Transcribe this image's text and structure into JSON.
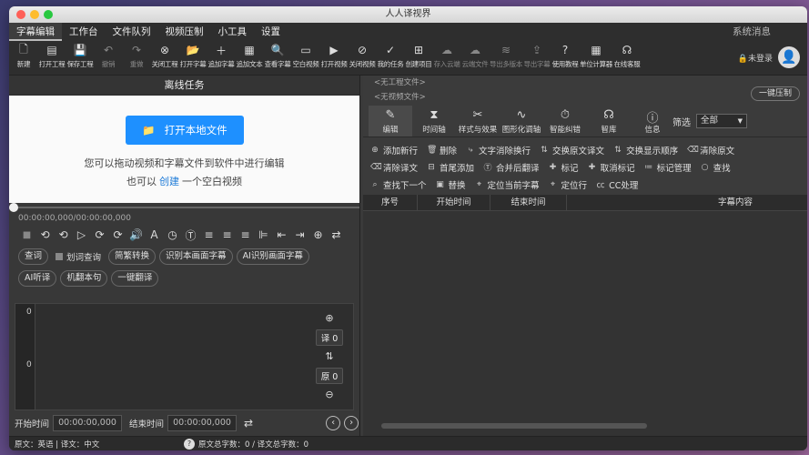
{
  "window": {
    "title": "人人译视界"
  },
  "menu": {
    "items": [
      "字幕编辑",
      "工作台",
      "文件队列",
      "视频压制",
      "小工具",
      "设置"
    ],
    "active_index": 0,
    "system_message": "系统消息"
  },
  "toolbar": {
    "items": [
      {
        "label": "新建",
        "icon": "new-file-icon",
        "glyph": "🗋"
      },
      {
        "label": "打开工程",
        "icon": "open-project-icon",
        "glyph": "▤"
      },
      {
        "label": "保存工程",
        "icon": "save-icon",
        "glyph": "💾"
      },
      {
        "label": "撤销",
        "icon": "undo-icon",
        "glyph": "↶"
      },
      {
        "label": "重做",
        "icon": "redo-icon",
        "glyph": "↷"
      },
      {
        "label": "关闭工程",
        "icon": "close-project-icon",
        "glyph": "⊗"
      },
      {
        "label": "打开字幕",
        "icon": "open-subtitle-icon",
        "glyph": "📂"
      },
      {
        "label": "追加字幕",
        "icon": "append-subtitle-icon",
        "glyph": "＋"
      },
      {
        "label": "追加文本",
        "icon": "append-text-icon",
        "glyph": "▦"
      },
      {
        "label": "查看字幕",
        "icon": "view-subtitle-icon",
        "glyph": "🔍"
      },
      {
        "label": "空白视频",
        "icon": "blank-video-icon",
        "glyph": "▭"
      },
      {
        "label": "打开视频",
        "icon": "open-video-icon",
        "glyph": "▶"
      },
      {
        "label": "关闭视频",
        "icon": "close-video-icon",
        "glyph": "⊘"
      },
      {
        "label": "我的任务",
        "icon": "task-icon",
        "glyph": "✓"
      },
      {
        "label": "创建项目",
        "icon": "create-project-icon",
        "glyph": "⊞"
      },
      {
        "label": "存入云端",
        "icon": "cloud-save-icon",
        "glyph": "☁"
      },
      {
        "label": "云端文件",
        "icon": "cloud-file-icon",
        "glyph": "☁"
      },
      {
        "label": "导出多版本",
        "icon": "export-versions-icon",
        "glyph": "≋"
      },
      {
        "label": "导出字幕",
        "icon": "export-subtitle-icon",
        "glyph": "⇪"
      },
      {
        "label": "使用教程",
        "icon": "help-icon",
        "glyph": "?"
      },
      {
        "label": "单位计算器",
        "icon": "calculator-icon",
        "glyph": "▦"
      },
      {
        "label": "在线客服",
        "icon": "headset-icon",
        "glyph": "☊"
      }
    ],
    "login_label": "未登录"
  },
  "left_panel": {
    "title": "离线任务",
    "open_button": "打开本地文件",
    "hint_line1": "您可以拖动视频和字幕文件到软件中进行编辑",
    "hint_prefix": "也可以",
    "hint_link": "创建",
    "hint_suffix": "一个空白视频",
    "timecode": "00:00:00,000/00:00:00,000",
    "row1": {
      "query": "查词",
      "check_label": "划词查询",
      "convert": "简繁转换",
      "recognize": "识别本画面字幕",
      "ai_recognize": "AI识别画面字幕"
    },
    "row2": {
      "ai_listen": "AI听译",
      "machine": "机翻本句",
      "one_click": "一键翻译"
    },
    "editor": {
      "line_top": "0",
      "line_bottom": "0",
      "translation_count": "译 0",
      "original_count": "原 0"
    },
    "start_label": "开始时间",
    "start_value": "00:00:00,000",
    "end_label": "结束时间",
    "end_value": "00:00:00,000"
  },
  "right_panel": {
    "project_line1": "<无工程文件>",
    "project_line2": "<无视频文件>",
    "compress_button": "一键压制",
    "tabs": [
      {
        "label": "编辑",
        "icon": "edit-icon",
        "glyph": "✎"
      },
      {
        "label": "时间轴",
        "icon": "timeline-icon",
        "glyph": "⧗"
      },
      {
        "label": "样式与效果",
        "icon": "style-icon",
        "glyph": "✂"
      },
      {
        "label": "图形化调轴",
        "icon": "graph-icon",
        "glyph": "∿"
      },
      {
        "label": "智能纠错",
        "icon": "smart-fix-icon",
        "glyph": "⏱"
      },
      {
        "label": "智库",
        "icon": "library-icon",
        "glyph": "☊"
      },
      {
        "label": "信息",
        "icon": "info-icon",
        "glyph": "ⓘ"
      }
    ],
    "filter_label": "筛选",
    "filter_value": "全部",
    "actions_row1": [
      {
        "label": "添加新行",
        "glyph": "⊕",
        "icon": "add-row-icon"
      },
      {
        "label": "删除",
        "glyph": "🗑",
        "icon": "delete-icon"
      },
      {
        "label": "文字消除换行",
        "glyph": "⤷",
        "icon": "remove-linebreak-icon"
      },
      {
        "label": "交换原文译文",
        "glyph": "⇅",
        "icon": "swap-text-icon"
      },
      {
        "label": "交换显示顺序",
        "glyph": "⇅",
        "icon": "swap-order-icon"
      },
      {
        "label": "清除原文",
        "glyph": "⌫",
        "icon": "clear-original-icon"
      }
    ],
    "actions_row2": [
      {
        "label": "清除译文",
        "glyph": "⌫",
        "icon": "clear-translation-icon"
      },
      {
        "label": "首尾添加",
        "glyph": "⊟",
        "icon": "add-ends-icon"
      },
      {
        "label": "合并后翻译",
        "glyph": "Ⓣ",
        "icon": "merge-translate-icon"
      },
      {
        "label": "标记",
        "glyph": "✚",
        "icon": "mark-icon"
      },
      {
        "label": "取消标记",
        "glyph": "✚",
        "icon": "unmark-icon"
      },
      {
        "label": "标记管理",
        "glyph": "≔",
        "icon": "mark-manage-icon"
      },
      {
        "label": "查找",
        "glyph": "○",
        "icon": "find-icon"
      }
    ],
    "actions_row3": [
      {
        "label": "查找下一个",
        "glyph": "⌕",
        "icon": "find-next-icon"
      },
      {
        "label": "替换",
        "glyph": "▣",
        "icon": "replace-icon"
      },
      {
        "label": "定位当前字幕",
        "glyph": "⌖",
        "icon": "locate-subtitle-icon"
      },
      {
        "label": "定位行",
        "glyph": "⌖",
        "icon": "locate-row-icon"
      },
      {
        "label": "CC处理",
        "glyph": "㏄",
        "icon": "cc-icon"
      }
    ],
    "table_headers": [
      "序号",
      "开始时间",
      "结束时间",
      "字幕内容"
    ]
  },
  "statusbar": {
    "language": "原文：英语 | 译文：中文",
    "counts": "原文总字数：0 / 译文总字数：0"
  }
}
